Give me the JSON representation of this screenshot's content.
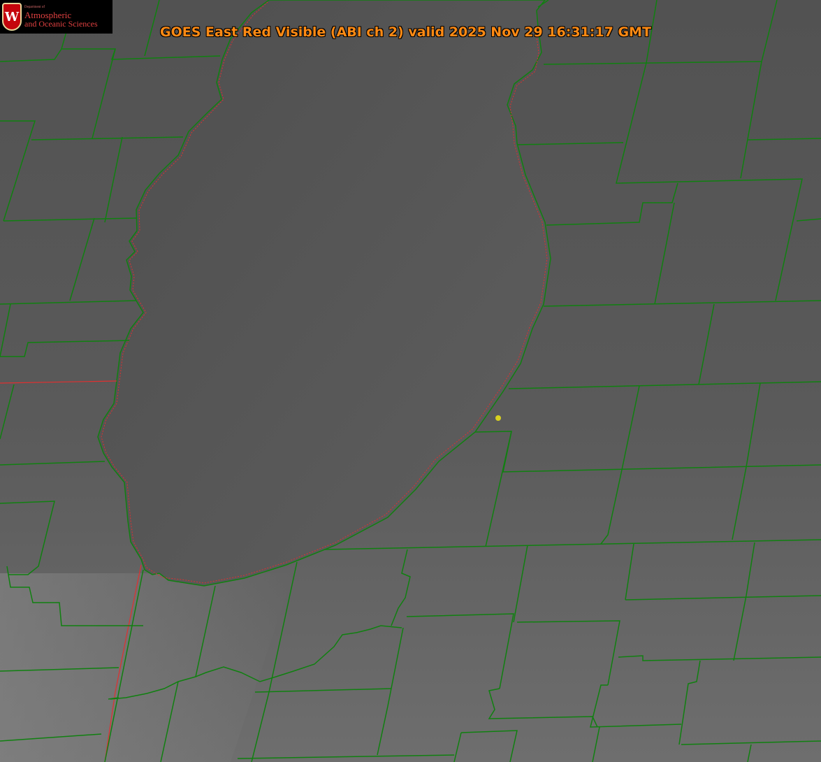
{
  "title": "GOES East Red Visible (ABI ch 2) valid 2025 Nov 29 16:31:17 GMT",
  "logo": {
    "dept_line": "Department of",
    "name_line1": "Atmospheric",
    "name_line2": "and Oceanic Sciences",
    "crest_letter": "W",
    "crest_color": "#c5050c"
  },
  "colors": {
    "county_lines": "#108010",
    "state_border": "#e03030",
    "marker": "#d8d020",
    "title_text": "#ff8a14"
  },
  "icons": [
    "uw-crest-icon",
    "location-marker-icon"
  ]
}
